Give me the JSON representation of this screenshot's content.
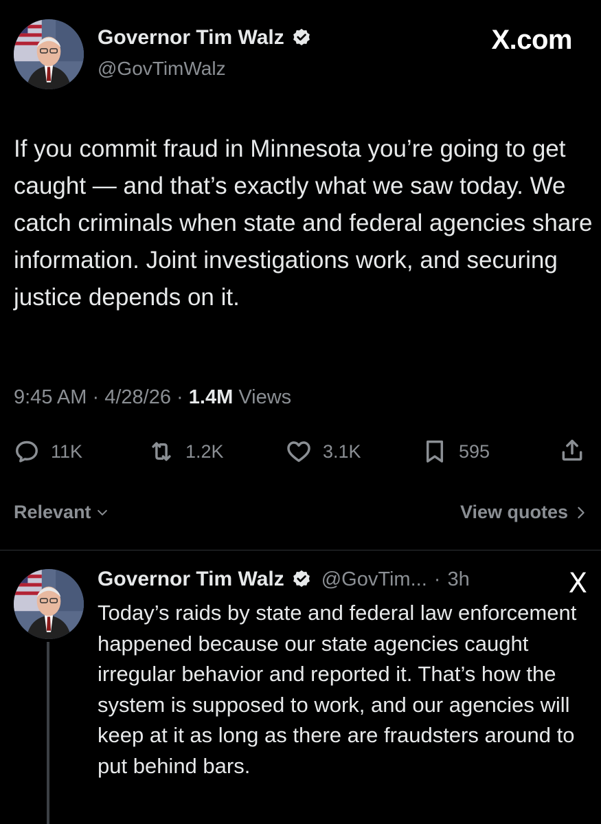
{
  "brand": "X.com",
  "main_tweet": {
    "author_name": "Governor Tim Walz",
    "handle": "@GovTimWalz",
    "text": "If you commit fraud in Minnesota you’re going to get caught — and that’s exactly what we saw today. We catch criminals when state and federal agencies share information. Joint investigations work, and securing justice depends on it.",
    "time": "9:45 AM",
    "date": "4/28/26",
    "separator": "·",
    "views_count": "1.4M",
    "views_label": "Views"
  },
  "actions": {
    "replies": "11K",
    "reposts": "1.2K",
    "likes": "3.1K",
    "bookmarks": "595"
  },
  "filter": {
    "sort_label": "Relevant",
    "view_quotes_label": "View quotes"
  },
  "reply_tweet": {
    "author_name": "Governor Tim Walz",
    "handle": "@GovTim...",
    "separator": "·",
    "time": "3h",
    "logo": "X",
    "text": "Today’s raids by state and federal law enforcement happened because our state agencies caught irregular behavior and reported it. That’s how the system is supposed to work, and our agencies will keep at it as long as there are fraudsters around to put behind bars."
  },
  "colors": {
    "background": "#000000",
    "text_primary": "#e7e9ea",
    "text_secondary": "#8b8f94",
    "divider": "#2f3336"
  },
  "icons": [
    "reply-icon",
    "repost-icon",
    "like-icon",
    "bookmark-icon",
    "share-icon",
    "verified-badge-icon",
    "chevron-down-icon",
    "chevron-right-icon"
  ]
}
